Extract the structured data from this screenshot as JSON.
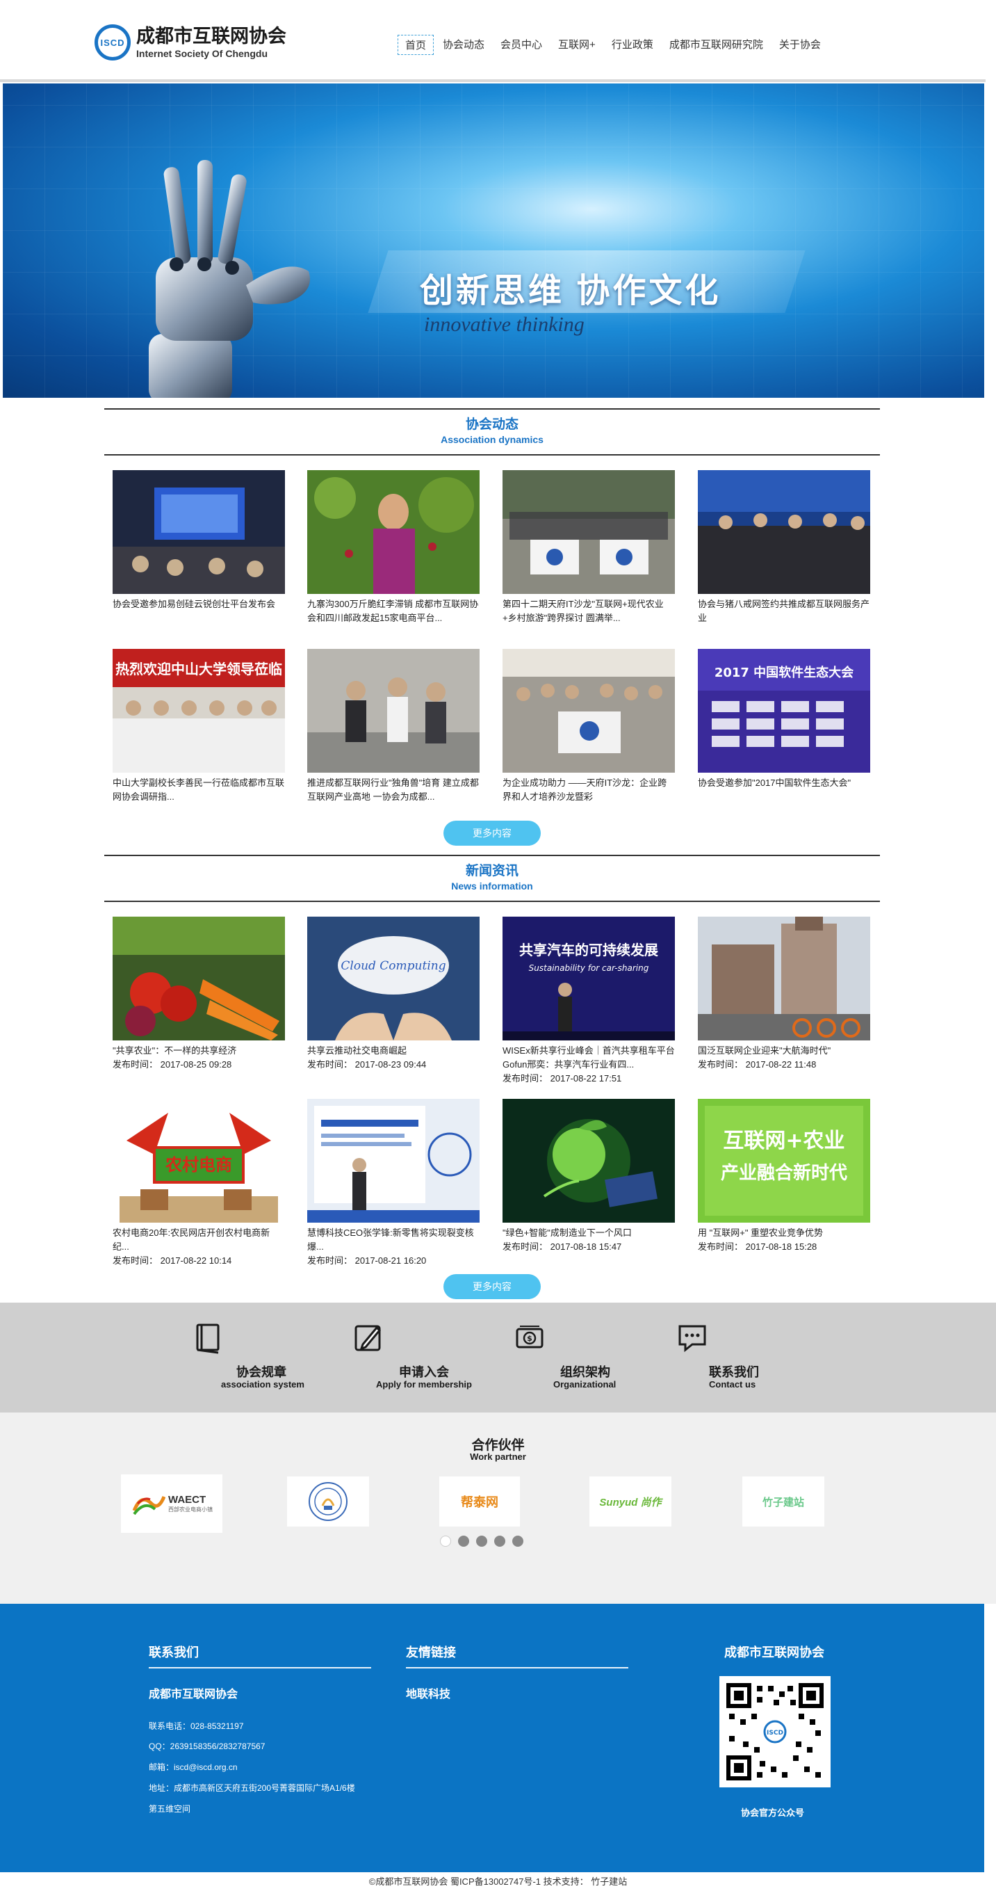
{
  "header": {
    "logo_badge": "ISCD",
    "logo_cn": "成都市互联网协会",
    "logo_en": "Internet Society Of Chengdu",
    "nav": [
      "首页",
      "协会动态",
      "会员中心",
      "互联网+",
      "行业政策",
      "成都市互联网研究院",
      "关于协会"
    ]
  },
  "banner": {
    "title": "创新思维  协作文化",
    "subtitle": "innovative thinking",
    "dots": [
      "1",
      "2",
      "3"
    ],
    "active_dot": 0
  },
  "dynamics": {
    "title_cn": "协会动态",
    "title_en": "Association dynamics",
    "items": [
      {
        "title": "协会受邀参加易创硅云锐创壮平台发布会"
      },
      {
        "title": "九寨沟300万斤脆红李滞销 成都市互联网协会和四川邮政发起15家电商平台..."
      },
      {
        "title": "第四十二期天府IT沙龙\"互联网+现代农业+乡村旅游\"跨界探讨 圆满举..."
      },
      {
        "title": "协会与猪八戒网签约共推成都互联网服务产业"
      },
      {
        "title": "中山大学副校长李善民一行莅临成都市互联网协会调研指..."
      },
      {
        "title": "推进成都互联网行业\"独角兽\"培育 建立成都互联网产业高地 一协会为成都..."
      },
      {
        "title": "为企业成功助力 ——天府IT沙龙：企业跨界和人才培养沙龙暨彩"
      },
      {
        "title": "协会受邀参加\"2017中国软件生态大会\""
      }
    ],
    "more": "更多内容"
  },
  "news": {
    "title_cn": "新闻资讯",
    "title_en": "News information",
    "date_prefix": "发布时间：",
    "items": [
      {
        "title": "\"共享农业\"：不一样的共享经济",
        "date": "2017-08-25 09:28"
      },
      {
        "title": "共享云推动社交电商崛起",
        "date": "2017-08-23 09:44"
      },
      {
        "title": "WISEx新共享行业峰会｜首汽共享租车平台Gofun邢奕：共享汽车行业有四...",
        "date": "2017-08-22 17:51"
      },
      {
        "title": "国泛互联网企业迎来\"大航海时代\"",
        "date": "2017-08-22 11:48"
      },
      {
        "title": "农村电商20年:农民网店开创农村电商新纪...",
        "date": "2017-08-22 10:14"
      },
      {
        "title": "慧博科技CEO张学锋:新零售将实现裂变核爆...",
        "date": "2017-08-21 16:20"
      },
      {
        "title": "\"绿色+智能\"成制造业下一个风口",
        "date": "2017-08-18 15:47"
      },
      {
        "title": "用 \"互联网+\" 重塑农业竞争优势",
        "date": "2017-08-18 15:28"
      }
    ],
    "more": "更多内容"
  },
  "images": {
    "n0_text": "Cloud Computing",
    "n2_text": "共享汽车的可持续发展",
    "n2_sub": "Sustainability for car-sharing",
    "n4_text": "农村电商",
    "n7_text": "互联网+农业 产业融合新时代",
    "d0_text": "热烈欢迎中山大学领导莅临",
    "d7_text": "2017 中国软件生态大会"
  },
  "quick_links": [
    {
      "cn": "协会规章",
      "en": "association system",
      "icon": "book-icon"
    },
    {
      "cn": "申请入会",
      "en": "Apply for membership",
      "icon": "pen-icon"
    },
    {
      "cn": "组织架构",
      "en": "Organizational",
      "icon": "money-icon"
    },
    {
      "cn": "联系我们",
      "en": "Contact us",
      "icon": "chat-icon"
    }
  ],
  "partners": {
    "title_cn": "合作伙伴",
    "title_en": "Work partner",
    "logos": [
      "WAECT",
      "",
      "帮泰网",
      "Sunyud 尚作",
      "竹子建站"
    ],
    "logo_sub": "西部农业电商小镇"
  },
  "footer": {
    "contact_head": "联系我们",
    "org_name": "成都市互联网协会",
    "phone": "联系电话：028-85321197",
    "qq": "QQ：2639158356/2832787567",
    "email": "邮箱：iscd@iscd.org.cn",
    "address1": "地址：成都市高新区天府五街200号菁蓉国际广场A1/6楼",
    "address2": "第五维空间",
    "links_head": "友情链接",
    "link1": "地联科技",
    "qr_head": "成都市互联网协会",
    "qr_caption": "协会官方公众号",
    "qr_center": "ISCD"
  },
  "copyright": "©成都市互联网协会 蜀ICP备13002747号-1 技术支持： 竹子建站",
  "colors": {
    "brand": "#1a74c5",
    "button": "#4fc3f0",
    "footer": "#0b74c4"
  }
}
